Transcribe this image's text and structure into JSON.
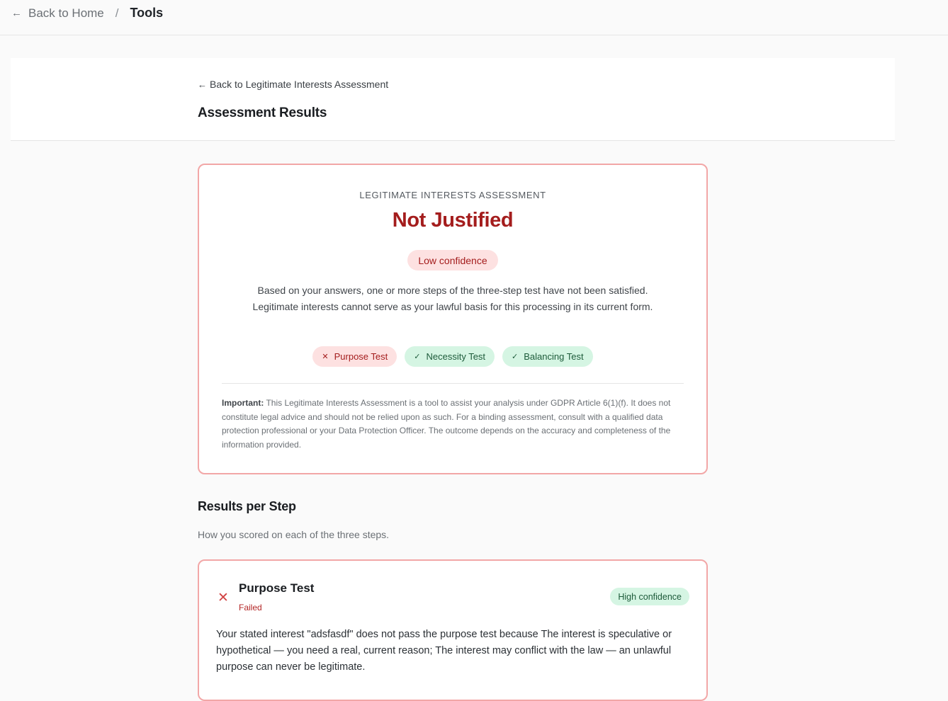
{
  "breadcrumb": {
    "back_label": "Back to Home",
    "separator": "/",
    "current": "Tools"
  },
  "header": {
    "back_link": "Back to Legitimate Interests Assessment",
    "title": "Assessment Results"
  },
  "result": {
    "eyebrow": "LEGITIMATE INTERESTS ASSESSMENT",
    "verdict": "Not Justified",
    "confidence": "Low confidence",
    "summary": "Based on your answers, one or more steps of the three-step test have not been satisfied. Legitimate interests cannot serve as your lawful basis for this processing in its current form.",
    "tests": [
      {
        "label": "Purpose Test",
        "status": "fail",
        "mark": "✕"
      },
      {
        "label": "Necessity Test",
        "status": "pass",
        "mark": "✓"
      },
      {
        "label": "Balancing Test",
        "status": "pass",
        "mark": "✓"
      }
    ],
    "disclaimer_label": "Important:",
    "disclaimer": "This Legitimate Interests Assessment is a tool to assist your analysis under GDPR Article 6(1)(f). It does not constitute legal advice and should not be relied upon as such. For a binding assessment, consult with a qualified data protection professional or your Data Protection Officer. The outcome depends on the accuracy and completeness of the information provided."
  },
  "steps_section": {
    "title": "Results per Step",
    "subtitle": "How you scored on each of the three steps."
  },
  "steps": [
    {
      "title": "Purpose Test",
      "status": "Failed",
      "confidence": "High confidence",
      "text": "Your stated interest \"adsfasdf\" does not pass the purpose test because The interest is speculative or hypothetical — you need a real, current reason; The interest may conflict with the law — an unlawful purpose can never be legitimate."
    }
  ],
  "colors": {
    "fail": "#a41d1d",
    "fail_bg": "#fde1e1",
    "pass": "#1d5b3a",
    "pass_bg": "#d5f5e3",
    "card_border": "#f2a7a7"
  }
}
